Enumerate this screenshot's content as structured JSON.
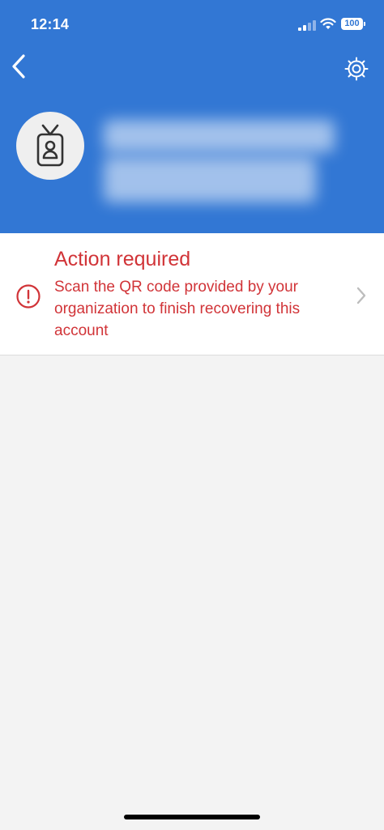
{
  "status_bar": {
    "time": "12:14",
    "battery": "100"
  },
  "header": {
    "background_color": "#3277d4",
    "back_icon": "chevron-left-icon",
    "settings_icon": "gear-icon",
    "avatar_icon": "id-badge-icon"
  },
  "alert": {
    "title": "Action required",
    "message": "Scan the QR code provided by your organization to finish recovering this account",
    "color": "#d13438",
    "icon": "exclamation-circle-icon",
    "chevron_icon": "chevron-right-icon"
  }
}
